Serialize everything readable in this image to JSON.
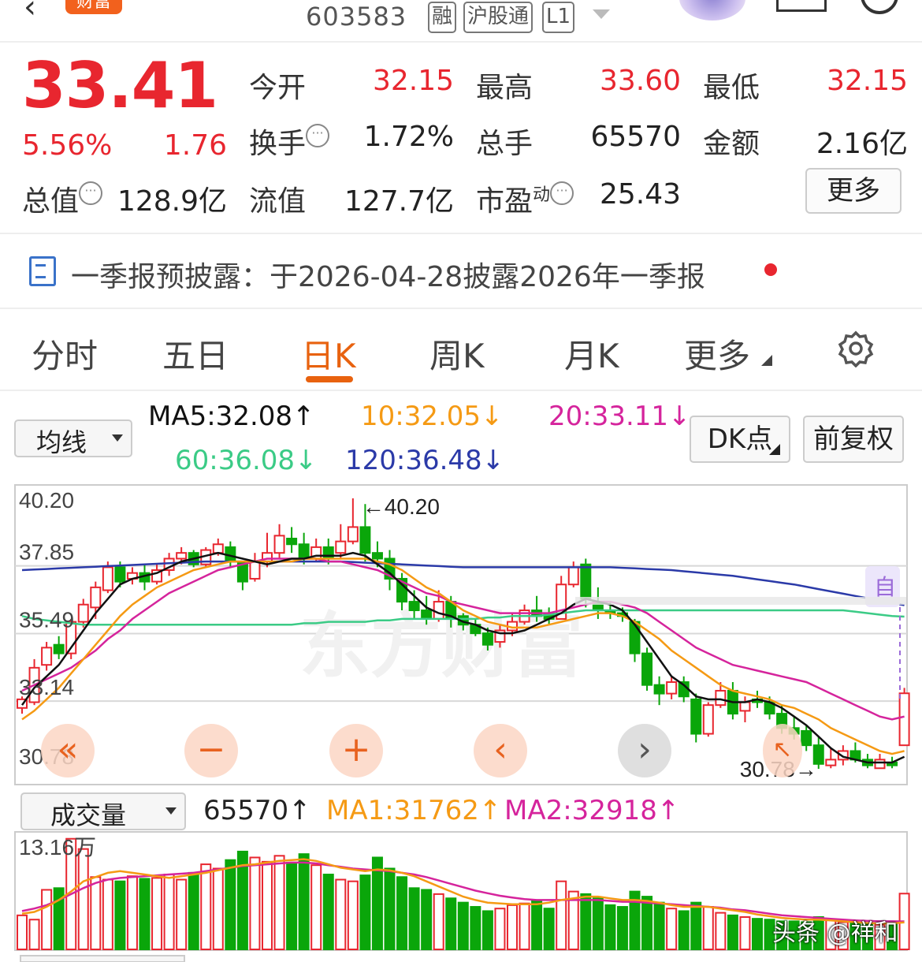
{
  "header": {
    "back_icon": "chevron-left-icon",
    "brand_badge": "财富",
    "stock_code": "603583",
    "tags": [
      "融",
      "沪股通",
      "L1"
    ]
  },
  "quote": {
    "price": "33.41",
    "change_pct": "5.56%",
    "change_amt": "1.76",
    "open_label": "今开",
    "open": "32.15",
    "high_label": "最高",
    "high": "33.60",
    "low_label": "最低",
    "low": "32.15",
    "turnover_label": "换手",
    "turnover": "1.72%",
    "volume_label": "总手",
    "volume": "65570",
    "amount_label": "金额",
    "amount": "2.16亿",
    "mcap_label": "总值",
    "mcap": "128.9亿",
    "float_label": "流值",
    "float_mcap": "127.7亿",
    "pe_label": "市盈",
    "pe_sup": "动",
    "pe": "25.43",
    "more_button": "更多"
  },
  "notice": {
    "text": "一季报预披露：于2026-04-28披露2026年一季报"
  },
  "tabs": [
    "分时",
    "五日",
    "日K",
    "周K",
    "月K",
    "更多"
  ],
  "active_tab": "日K",
  "indicators": {
    "ma_select": "均线",
    "ma5": "MA5:32.08↑",
    "ma10": "10:32.05↓",
    "ma20": "20:33.11↓",
    "ma60": "60:36.08↓",
    "ma120": "120:36.48↓",
    "dk_button": "DK点",
    "adjust_button": "前复权"
  },
  "colors": {
    "up": "#e8262f",
    "down": "#0aa60a",
    "ma5": "#111111",
    "ma10": "#f59a14",
    "ma20": "#d5249c",
    "ma60": "#3bcb86",
    "ma120": "#2b3aa8",
    "accent": "#e8620f"
  },
  "chart_data": [
    {
      "type": "candlestick",
      "y_ticks": [
        "40.20",
        "37.85",
        "35.49",
        "33.14",
        "30.78"
      ],
      "ylim": [
        30.78,
        40.2
      ],
      "max_label": "←40.20",
      "min_label": "30.78→",
      "candles": [
        [
          32.9,
          33.2,
          32.7,
          33.3
        ],
        [
          33.1,
          34.3,
          33.0,
          34.6
        ],
        [
          34.4,
          35.0,
          34.2,
          35.2
        ],
        [
          35.1,
          34.8,
          34.6,
          35.4
        ],
        [
          34.8,
          35.9,
          34.6,
          36.0
        ],
        [
          35.9,
          36.5,
          35.7,
          36.7
        ],
        [
          36.4,
          37.1,
          36.0,
          37.3
        ],
        [
          37.0,
          37.8,
          36.9,
          38.0
        ],
        [
          37.8,
          37.3,
          37.1,
          38.0
        ],
        [
          37.4,
          37.6,
          37.2,
          37.8
        ],
        [
          37.6,
          37.3,
          37.0,
          37.9
        ],
        [
          37.3,
          37.7,
          37.2,
          37.9
        ],
        [
          37.7,
          38.1,
          37.5,
          38.3
        ],
        [
          38.1,
          38.3,
          37.9,
          38.5
        ],
        [
          38.3,
          37.9,
          37.8,
          38.4
        ],
        [
          37.9,
          38.4,
          37.8,
          38.5
        ],
        [
          38.3,
          38.6,
          38.2,
          38.8
        ],
        [
          38.5,
          38.0,
          37.8,
          38.7
        ],
        [
          38.0,
          37.3,
          37.0,
          38.0
        ],
        [
          37.4,
          38.0,
          37.3,
          38.3
        ],
        [
          38.0,
          38.3,
          37.8,
          39.0
        ],
        [
          38.3,
          38.9,
          38.1,
          39.3
        ],
        [
          38.8,
          38.6,
          38.3,
          39.2
        ],
        [
          38.6,
          38.1,
          37.9,
          39.0
        ],
        [
          38.1,
          38.5,
          38.0,
          38.8
        ],
        [
          38.5,
          38.1,
          37.9,
          38.8
        ],
        [
          38.3,
          38.7,
          38.1,
          39.3
        ],
        [
          38.7,
          39.2,
          38.6,
          40.2
        ],
        [
          39.2,
          38.3,
          38.0,
          40.0
        ],
        [
          38.3,
          38.1,
          37.8,
          38.7
        ],
        [
          38.1,
          37.4,
          37.0,
          38.4
        ],
        [
          37.4,
          36.6,
          36.3,
          37.6
        ],
        [
          36.6,
          36.3,
          36.0,
          37.0
        ],
        [
          36.3,
          36.0,
          35.8,
          36.8
        ],
        [
          36.0,
          36.6,
          35.9,
          37.0
        ],
        [
          36.6,
          36.0,
          35.7,
          36.8
        ],
        [
          36.1,
          35.8,
          35.6,
          36.2
        ],
        [
          35.8,
          35.5,
          35.4,
          36.0
        ],
        [
          35.5,
          35.1,
          34.9,
          35.7
        ],
        [
          35.2,
          35.6,
          35.0,
          35.8
        ],
        [
          35.6,
          35.9,
          35.4,
          36.2
        ],
        [
          35.9,
          36.3,
          35.8,
          36.5
        ],
        [
          36.3,
          36.1,
          35.9,
          36.8
        ],
        [
          36.2,
          36.0,
          35.8,
          36.4
        ],
        [
          36.0,
          37.2,
          36.0,
          37.5
        ],
        [
          37.2,
          37.8,
          37.1,
          38.0
        ],
        [
          37.9,
          36.7,
          36.4,
          38.1
        ],
        [
          36.6,
          36.3,
          36.0,
          37.1
        ],
        [
          36.3,
          36.2,
          36.0,
          36.6
        ],
        [
          36.2,
          36.1,
          35.9,
          36.4
        ],
        [
          35.9,
          34.8,
          34.5,
          36.0
        ],
        [
          34.8,
          33.7,
          33.5,
          35.0
        ],
        [
          33.7,
          33.4,
          33.0,
          34.0
        ],
        [
          33.4,
          33.8,
          33.2,
          34.0
        ],
        [
          33.8,
          33.3,
          33.1,
          34.0
        ],
        [
          33.2,
          32.0,
          31.7,
          33.4
        ],
        [
          32.0,
          33.0,
          31.9,
          33.1
        ],
        [
          33.0,
          33.5,
          32.9,
          33.8
        ],
        [
          33.5,
          32.7,
          32.5,
          33.8
        ],
        [
          32.8,
          33.1,
          32.4,
          33.3
        ],
        [
          33.2,
          33.1,
          32.9,
          33.5
        ],
        [
          33.1,
          32.7,
          32.5,
          33.3
        ],
        [
          32.7,
          32.2,
          32.0,
          33.0
        ],
        [
          32.2,
          32.0,
          31.8,
          32.6
        ],
        [
          32.1,
          31.6,
          31.4,
          32.3
        ],
        [
          31.6,
          30.95,
          30.78,
          31.9
        ],
        [
          30.9,
          31.1,
          30.8,
          31.5
        ],
        [
          31.1,
          31.4,
          30.9,
          31.6
        ],
        [
          31.4,
          31.1,
          31.0,
          31.7
        ],
        [
          31.1,
          30.9,
          30.8,
          31.3
        ],
        [
          30.8,
          31.1,
          30.8,
          31.3
        ],
        [
          31.0,
          30.9,
          30.8,
          31.2
        ],
        [
          31.6,
          33.41,
          31.6,
          33.6
        ]
      ],
      "ma5": [
        33.0,
        33.6,
        34.0,
        34.4,
        35.0,
        35.6,
        36.2,
        36.7,
        37.2,
        37.4,
        37.5,
        37.6,
        37.8,
        38.0,
        38.1,
        38.2,
        38.3,
        38.2,
        38.1,
        38.0,
        37.9,
        38.0,
        38.1,
        38.1,
        38.2,
        38.2,
        38.2,
        38.3,
        38.2,
        37.9,
        37.6,
        37.2,
        36.8,
        36.4,
        36.2,
        36.1,
        35.9,
        35.8,
        35.6,
        35.5,
        35.5,
        35.6,
        35.8,
        36.0,
        36.2,
        36.5,
        36.7,
        36.6,
        36.5,
        36.3,
        35.8,
        35.2,
        34.6,
        34.0,
        33.7,
        33.3,
        33.2,
        33.2,
        33.1,
        33.1,
        33.2,
        33.1,
        32.9,
        32.6,
        32.3,
        31.9,
        31.5,
        31.2,
        31.1,
        31.0,
        31.0,
        31.0,
        31.2
      ],
      "ma10": [
        32.5,
        32.8,
        33.2,
        33.6,
        34.1,
        34.6,
        35.1,
        35.6,
        36.1,
        36.5,
        36.8,
        37.1,
        37.3,
        37.5,
        37.7,
        37.8,
        37.9,
        38.0,
        38.0,
        38.0,
        38.0,
        38.0,
        38.0,
        38.1,
        38.1,
        38.1,
        38.1,
        38.1,
        38.1,
        38.0,
        37.9,
        37.7,
        37.4,
        37.1,
        36.9,
        36.6,
        36.3,
        36.1,
        35.9,
        35.8,
        35.7,
        35.7,
        35.7,
        35.8,
        35.9,
        36.0,
        36.1,
        36.2,
        36.2,
        36.1,
        35.9,
        35.6,
        35.3,
        34.9,
        34.6,
        34.3,
        34.0,
        33.7,
        33.5,
        33.4,
        33.3,
        33.2,
        33.0,
        32.9,
        32.7,
        32.5,
        32.2,
        32.0,
        31.8,
        31.6,
        31.4,
        31.3,
        31.4
      ],
      "ma20": [
        33.5,
        33.7,
        33.9,
        34.1,
        34.3,
        34.6,
        34.9,
        35.3,
        35.6,
        36.0,
        36.3,
        36.6,
        36.9,
        37.1,
        37.3,
        37.5,
        37.7,
        37.8,
        37.9,
        38.0,
        38.1,
        38.1,
        38.1,
        38.1,
        38.1,
        38.0,
        38.0,
        37.9,
        37.8,
        37.7,
        37.5,
        37.3,
        37.1,
        36.9,
        36.8,
        36.6,
        36.5,
        36.4,
        36.3,
        36.2,
        36.2,
        36.2,
        36.2,
        36.2,
        36.3,
        36.4,
        36.5,
        36.6,
        36.6,
        36.5,
        36.4,
        36.2,
        35.9,
        35.6,
        35.3,
        35.0,
        34.8,
        34.6,
        34.4,
        34.3,
        34.2,
        34.1,
        34.0,
        33.9,
        33.8,
        33.6,
        33.4,
        33.2,
        33.0,
        32.8,
        32.6,
        32.5,
        32.6
      ],
      "ma60": [
        36.1,
        36.0,
        35.95,
        35.9,
        35.85,
        35.8,
        35.8,
        35.8,
        35.8,
        35.8,
        35.8,
        35.8,
        35.8,
        35.8,
        35.8,
        35.8,
        35.8,
        35.8,
        35.8,
        35.8,
        35.8,
        35.8,
        35.8,
        35.85,
        35.85,
        35.9,
        35.9,
        35.9,
        35.9,
        35.95,
        35.95,
        36.0,
        36.0,
        36.0,
        36.0,
        36.0,
        36.0,
        36.0,
        36.05,
        36.05,
        36.1,
        36.1,
        36.1,
        36.15,
        36.2,
        36.25,
        36.3,
        36.3,
        36.3,
        36.3,
        36.3,
        36.3,
        36.3,
        36.3,
        36.3,
        36.3,
        36.3,
        36.3,
        36.3,
        36.3,
        36.3,
        36.3,
        36.3,
        36.3,
        36.3,
        36.3,
        36.3,
        36.3,
        36.25,
        36.2,
        36.15,
        36.1,
        36.08
      ],
      "ma120": [
        37.7,
        37.72,
        37.74,
        37.76,
        37.78,
        37.8,
        37.82,
        37.84,
        37.86,
        37.88,
        37.9,
        37.92,
        37.94,
        37.96,
        37.98,
        38.0,
        38.0,
        38.0,
        38.0,
        38.0,
        38.0,
        38.0,
        38.0,
        38.0,
        38.0,
        38.0,
        38.0,
        37.98,
        37.96,
        37.94,
        37.92,
        37.9,
        37.88,
        37.86,
        37.84,
        37.82,
        37.8,
        37.8,
        37.8,
        37.8,
        37.8,
        37.8,
        37.8,
        37.8,
        37.8,
        37.8,
        37.8,
        37.8,
        37.8,
        37.78,
        37.76,
        37.74,
        37.72,
        37.7,
        37.66,
        37.62,
        37.58,
        37.54,
        37.5,
        37.44,
        37.38,
        37.32,
        37.26,
        37.2,
        37.12,
        37.04,
        36.96,
        36.88,
        36.8,
        36.72,
        36.64,
        36.56,
        36.48
      ]
    },
    {
      "type": "bar",
      "y_ticks": [
        "13.16万"
      ],
      "ylim": [
        0,
        131600
      ],
      "volume": [
        40000,
        35000,
        70000,
        72000,
        130000,
        118000,
        85000,
        82000,
        80000,
        86000,
        83000,
        84000,
        88000,
        82000,
        90000,
        100000,
        95000,
        105000,
        115000,
        108000,
        103000,
        110000,
        102000,
        112000,
        99000,
        88000,
        82000,
        80000,
        87000,
        108000,
        95000,
        85000,
        72000,
        70000,
        65000,
        60000,
        55000,
        50000,
        45000,
        48000,
        52000,
        54000,
        57000,
        48000,
        80000,
        68000,
        65000,
        60000,
        52000,
        50000,
        68000,
        62000,
        55000,
        48000,
        45000,
        55000,
        50000,
        43000,
        40000,
        38000,
        36000,
        35000,
        33000,
        33000,
        32000,
        38000,
        35000,
        32000,
        31000,
        30000,
        29000,
        30000,
        65570
      ],
      "ma1": [
        42000,
        44000,
        50000,
        58000,
        68000,
        80000,
        85000,
        90000,
        92000,
        90000,
        88000,
        86000,
        84000,
        86000,
        88000,
        90000,
        93000,
        96000,
        99000,
        100000,
        102000,
        104000,
        105000,
        106000,
        104000,
        100000,
        96000,
        94000,
        92000,
        94000,
        93000,
        90000,
        86000,
        80000,
        74000,
        68000,
        62000,
        58000,
        55000,
        54000,
        53000,
        53000,
        53000,
        55000,
        58000,
        60000,
        62000,
        62000,
        60000,
        58000,
        58000,
        57000,
        55000,
        52000,
        50000,
        50000,
        50000,
        48000,
        46000,
        44000,
        41000,
        39000,
        37000,
        36000,
        35000,
        35000,
        34000,
        33000,
        32000,
        31000,
        30500,
        30500,
        31762
      ],
      "ma2": [
        45000,
        48000,
        52000,
        58000,
        65000,
        72000,
        78000,
        82000,
        84000,
        85000,
        86000,
        87000,
        88000,
        89000,
        90000,
        92000,
        94000,
        96000,
        98000,
        99000,
        100000,
        101000,
        102000,
        102000,
        101000,
        99000,
        97000,
        95000,
        94000,
        93000,
        92000,
        90000,
        88000,
        85000,
        81000,
        77000,
        73000,
        69000,
        66000,
        63000,
        61000,
        59000,
        58000,
        58000,
        58000,
        58000,
        58000,
        58000,
        57000,
        56000,
        56000,
        55000,
        54000,
        53000,
        52000,
        51000,
        50000,
        49000,
        47000,
        46000,
        44000,
        42000,
        40000,
        39000,
        38000,
        37000,
        36000,
        35000,
        34000,
        33500,
        33000,
        33000,
        32918
      ]
    }
  ],
  "volume_section": {
    "select": "成交量",
    "vol": "65570↑",
    "ma1": "MA1:31762↑",
    "ma2": "MA2:32918↑"
  },
  "badge_auto": "自",
  "watermark_chart": "东方财富",
  "watermark": "头条 @祥和"
}
